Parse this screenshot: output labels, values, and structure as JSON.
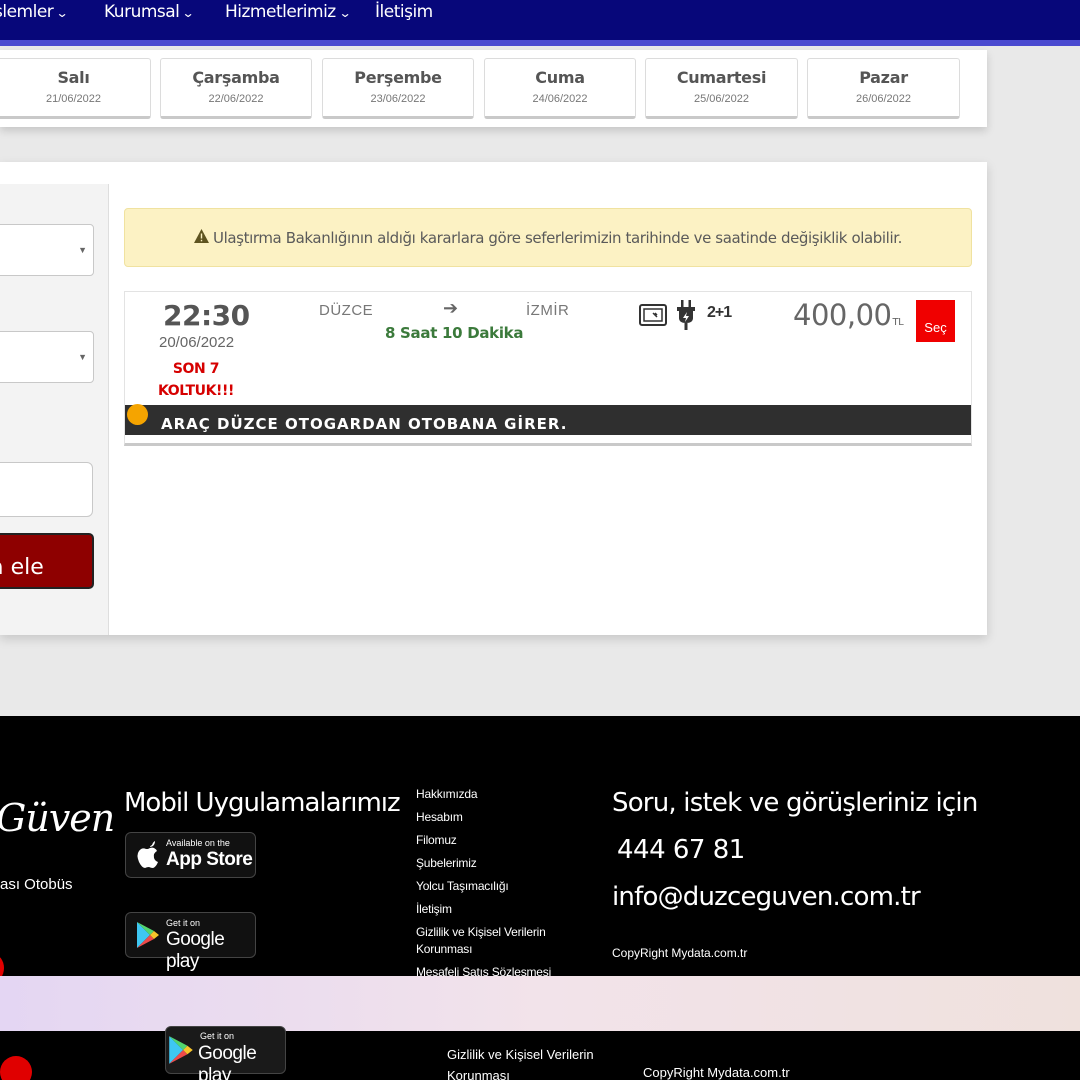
{
  "nav": {
    "items": [
      {
        "label": "şlemler"
      },
      {
        "label": "Kurumsal"
      },
      {
        "label": "Hizmetlerimiz"
      },
      {
        "label": "İletişim"
      }
    ]
  },
  "days": [
    {
      "name": "Salı",
      "date": "21/06/2022"
    },
    {
      "name": "Çarşamba",
      "date": "22/06/2022"
    },
    {
      "name": "Perşembe",
      "date": "23/06/2022"
    },
    {
      "name": "Cuma",
      "date": "24/06/2022"
    },
    {
      "name": "Cumartesi",
      "date": "25/06/2022"
    },
    {
      "name": "Pazar",
      "date": "26/06/2022"
    }
  ],
  "search": {
    "button_label": "Ara ele"
  },
  "notice": {
    "icon": "warning-icon",
    "text": "Ulaştırma Bakanlığının aldığı kararlara göre seferlerimizin tarihinde ve saatinde değişiklik olabilir."
  },
  "trip": {
    "time": "22:30",
    "date": "20/06/2022",
    "seats_line1": "SON 7",
    "seats_line2": "KOLTUK!!!",
    "from": "DÜZCE",
    "to": "İZMİR",
    "duration": "8 Saat 10 Dakika",
    "features": [
      "screen-icon",
      "plug-icon"
    ],
    "layout": "2+1",
    "price": "400,00",
    "currency": "TL",
    "select_label": "Seç",
    "banner": "ARAÇ DÜZCE OTOGARDAN OTOBANA GİRER."
  },
  "footer": {
    "logo_text": "Güven",
    "tagline": "ası Otobüs",
    "apps_title": "Mobil Uygulamalarımız",
    "appstore_small": "Available on the",
    "appstore_big": "App Store",
    "googleplay_small": "Get it on",
    "googleplay_big": "Google play",
    "links": [
      "Hakkımızda",
      "Hesabım",
      "Filomuz",
      "Şubelerimiz",
      "Yolcu Taşımacılığı",
      "İletişim",
      "Gizlilik ve Kişisel Verilerin Korunması",
      "Mesafeli Satış Sözleşmesi"
    ],
    "contact_title": "Soru, istek ve görüşleriniz için",
    "phone": "444 67 81",
    "email": "info@duzceguven.com.tr",
    "copyright": "CopyRight Mydata.com.tr"
  },
  "colors": {
    "nav_bg": "#07077a",
    "accent_red": "#f00000",
    "search_btn": "#8e0000",
    "notice_bg": "#fcf2c4",
    "duration_green": "#3b7a3b",
    "seats_red": "#d60000"
  }
}
